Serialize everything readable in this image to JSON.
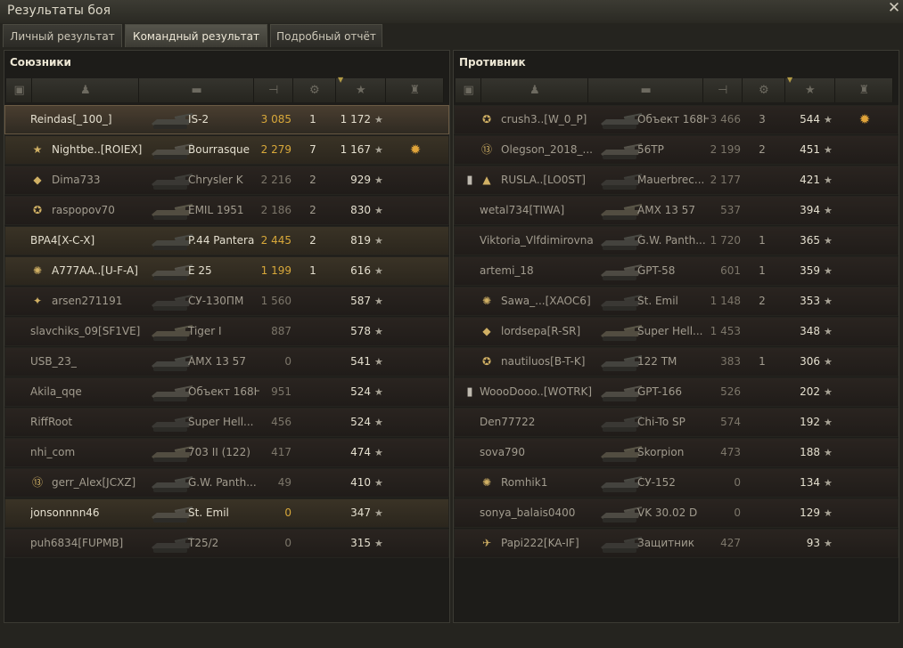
{
  "window": {
    "title": "Результаты боя",
    "close_icon": "close-icon"
  },
  "tabs": [
    {
      "label": "Личный результат",
      "active": false
    },
    {
      "label": "Командный результат",
      "active": true
    },
    {
      "label": "Подробный отчёт",
      "active": false
    }
  ],
  "allies": {
    "title": "Союзники",
    "rows": [
      {
        "player": "Reindas[_100_]",
        "vehicle": "IS-2",
        "damage": "3 085",
        "kills": "1",
        "xp": "1 172",
        "style": "self",
        "medal": "",
        "rank": ""
      },
      {
        "player": "Nightbe..[ROIEX]",
        "vehicle": "Bourrasque",
        "damage": "2 279",
        "kills": "7",
        "xp": "1 167",
        "style": "bright",
        "medal": "✹",
        "rank": "★"
      },
      {
        "player": "Dima733",
        "vehicle": "Chrysler K",
        "damage": "2 216",
        "kills": "2",
        "xp": "929",
        "style": "",
        "medal": "",
        "rank": "◆"
      },
      {
        "player": "raspopov70",
        "vehicle": "EMIL 1951",
        "damage": "2 186",
        "kills": "2",
        "xp": "830",
        "style": "",
        "medal": "",
        "rank": "✪"
      },
      {
        "player": "BPA4[X-C-X]",
        "vehicle": "P.44 Pantera",
        "damage": "2 445",
        "kills": "2",
        "xp": "819",
        "style": "bright",
        "medal": "",
        "rank": ""
      },
      {
        "player": "A777AA..[U-F-A]",
        "vehicle": "E 25",
        "damage": "1 199",
        "kills": "1",
        "xp": "616",
        "style": "bright",
        "medal": "",
        "rank": "✺"
      },
      {
        "player": "arsen271191",
        "vehicle": "СУ-130ПМ",
        "damage": "1 560",
        "kills": "",
        "xp": "587",
        "style": "",
        "medal": "",
        "rank": "✦"
      },
      {
        "player": "slavchiks_09[SF1VE]",
        "vehicle": "Tiger I",
        "damage": "887",
        "kills": "",
        "xp": "578",
        "style": "",
        "medal": "",
        "rank": ""
      },
      {
        "player": "USB_23_",
        "vehicle": "AMX 13 57",
        "damage": "0",
        "kills": "",
        "xp": "541",
        "style": "",
        "medal": "",
        "rank": ""
      },
      {
        "player": "Akila_qqe",
        "vehicle": "Объект 168Н",
        "damage": "951",
        "kills": "",
        "xp": "524",
        "style": "",
        "medal": "",
        "rank": ""
      },
      {
        "player": "RiffRoot",
        "vehicle": "Super Hell...",
        "damage": "456",
        "kills": "",
        "xp": "524",
        "style": "",
        "medal": "",
        "rank": ""
      },
      {
        "player": "nhi_com",
        "vehicle": "703 II (122)",
        "damage": "417",
        "kills": "",
        "xp": "474",
        "style": "",
        "medal": "",
        "rank": ""
      },
      {
        "player": "gerr_Alex[JCXZ]",
        "vehicle": "G.W. Panth...",
        "damage": "49",
        "kills": "",
        "xp": "410",
        "style": "",
        "medal": "",
        "rank": "⑬"
      },
      {
        "player": "jonsonnnn46",
        "vehicle": "St. Emil",
        "damage": "0",
        "kills": "",
        "xp": "347",
        "style": "bright",
        "medal": "",
        "rank": ""
      },
      {
        "player": "puh6834[FUPMB]",
        "vehicle": "T25/2",
        "damage": "0",
        "kills": "",
        "xp": "315",
        "style": "",
        "medal": "",
        "rank": ""
      }
    ]
  },
  "enemies": {
    "title": "Противник",
    "rows": [
      {
        "player": "crush3..[W_0_P]",
        "vehicle": "Объект 168Н",
        "damage": "3 466",
        "kills": "3",
        "xp": "544",
        "style": "",
        "medal": "✹",
        "rank": "✪"
      },
      {
        "player": "Olegson_2018_...",
        "vehicle": "56TP",
        "damage": "2 199",
        "kills": "2",
        "xp": "451",
        "style": "",
        "medal": "",
        "rank": "⑬"
      },
      {
        "player": "RUSLA..[LO0ST]",
        "vehicle": "Mauerbrec...",
        "damage": "2 177",
        "kills": "",
        "xp": "421",
        "style": "",
        "medal": "",
        "rank": "▲",
        "clan": "▮"
      },
      {
        "player": "wetal734[TIWA]",
        "vehicle": "AMX 13 57",
        "damage": "537",
        "kills": "",
        "xp": "394",
        "style": "",
        "medal": "",
        "rank": ""
      },
      {
        "player": "Viktoria_Vlfdimirovna",
        "vehicle": "G.W. Panth...",
        "damage": "1 720",
        "kills": "1",
        "xp": "365",
        "style": "",
        "medal": "",
        "rank": ""
      },
      {
        "player": "artemi_18",
        "vehicle": "GPT-58",
        "damage": "601",
        "kills": "1",
        "xp": "359",
        "style": "",
        "medal": "",
        "rank": ""
      },
      {
        "player": "Sawa_...[XAOC6]",
        "vehicle": "St. Emil",
        "damage": "1 148",
        "kills": "2",
        "xp": "353",
        "style": "",
        "medal": "",
        "rank": "✺"
      },
      {
        "player": "lordsepa[R-SR]",
        "vehicle": "Super Hell...",
        "damage": "1 453",
        "kills": "",
        "xp": "348",
        "style": "",
        "medal": "",
        "rank": "◆"
      },
      {
        "player": "nautiluos[B-T-K]",
        "vehicle": "122 TM",
        "damage": "383",
        "kills": "1",
        "xp": "306",
        "style": "",
        "medal": "",
        "rank": "✪"
      },
      {
        "player": "WoooDooo..[WOTRK]",
        "vehicle": "GPT-166",
        "damage": "526",
        "kills": "",
        "xp": "202",
        "style": "",
        "medal": "",
        "rank": "",
        "clan": "▮"
      },
      {
        "player": "Den77722",
        "vehicle": "Chi-To SP",
        "damage": "574",
        "kills": "",
        "xp": "192",
        "style": "",
        "medal": "",
        "rank": ""
      },
      {
        "player": "sova790",
        "vehicle": "Skorpion",
        "damage": "473",
        "kills": "",
        "xp": "188",
        "style": "",
        "medal": "",
        "rank": ""
      },
      {
        "player": "Romhik1",
        "vehicle": "СУ-152",
        "damage": "0",
        "kills": "",
        "xp": "134",
        "style": "",
        "medal": "",
        "rank": "✺"
      },
      {
        "player": "sonya_balais0400",
        "vehicle": "VK 30.02 D",
        "damage": "0",
        "kills": "",
        "xp": "129",
        "style": "",
        "medal": "",
        "rank": ""
      },
      {
        "player": "Papi222[KA-IF]",
        "vehicle": "Защитник",
        "damage": "427",
        "kills": "",
        "xp": "93",
        "style": "",
        "medal": "",
        "rank": "✈"
      }
    ]
  },
  "column_icons": [
    "platoon-icon",
    "player-icon",
    "tank-icon",
    "damage-icon",
    "kills-icon",
    "xp-star-icon",
    "medal-icon"
  ],
  "icons": {
    "star": "★",
    "header_player": "♟",
    "header_tank": "▬",
    "header_damage": "⊣",
    "header_kills": "⚙",
    "header_xp": "★",
    "header_medal": "♜",
    "header_platoon": "▣",
    "sort_arrow": "▼"
  },
  "colors": {
    "gold": "#d8a83a",
    "self_row": "#4a3e30"
  }
}
